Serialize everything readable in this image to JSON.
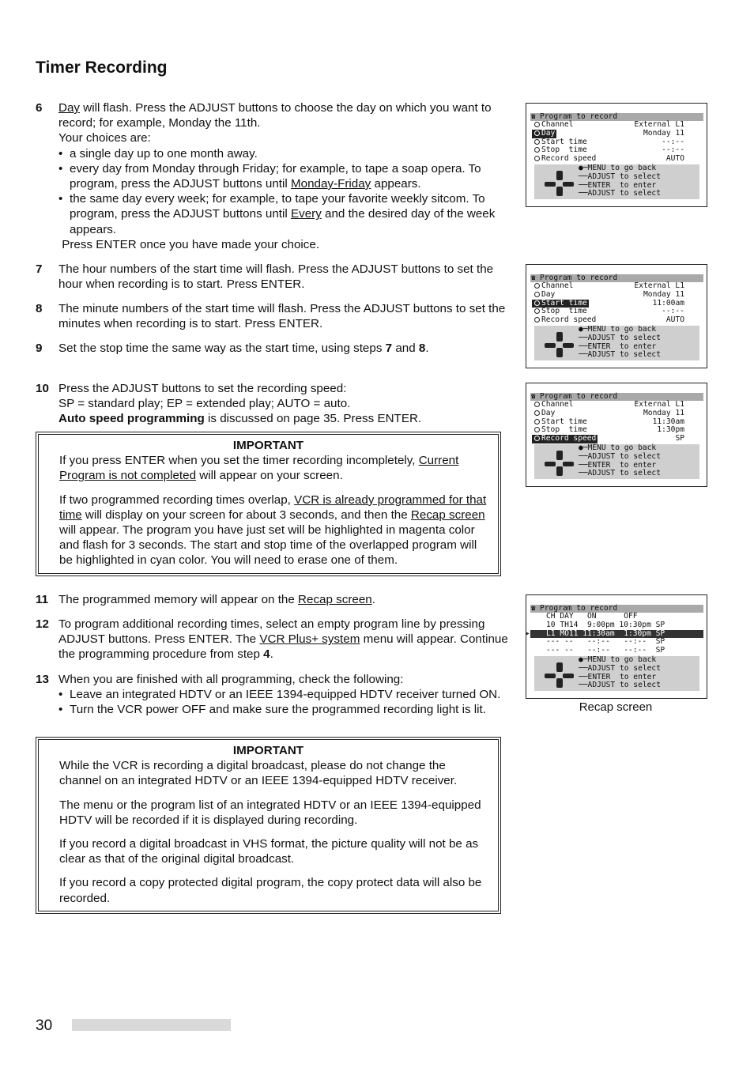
{
  "page": {
    "title": "Timer Recording",
    "page_number": "30"
  },
  "steps": {
    "s6": {
      "num": "6",
      "l1a": "Day",
      "l1b": " will flash.  Press the ADJUST buttons to choose the day on which you want to record; for example, Monday the 11th.",
      "l2": "Your choices are:",
      "b1": "a single day up to one month away.",
      "b2a": "every day from Monday through Friday; for example, to tape a soap opera. To program, press the ADJUST buttons until ",
      "b2u": "Monday-Friday",
      "b2b": " appears.",
      "b3a": "the same day every week; for example, to tape your favorite weekly sitcom. To program, press the ADJUST buttons until ",
      "b3u": "Every",
      "b3b": " and the desired day of the week appears.",
      "end": " Press ENTER once you have made your choice."
    },
    "s7": {
      "num": "7",
      "text": "The hour numbers of the start time will flash.  Press the ADJUST buttons to set the hour when recording is to start.  Press ENTER."
    },
    "s8": {
      "num": "8",
      "text": "The minute numbers of the start time will flash.  Press the ADJUST buttons to set the minutes when recording is to start.  Press ENTER."
    },
    "s9": {
      "num": "9",
      "a": "Set the stop time the same way as the start time, using steps ",
      "b1": "7",
      "m": " and ",
      "b2": "8",
      "e": "."
    },
    "s10": {
      "num": "10",
      "l1": "Press the ADJUST buttons to set the recording speed:",
      "l2": "SP = standard play; EP = extended play; AUTO = auto.",
      "l3b": "Auto speed programming",
      "l3": " is discussed on page 35.  Press ENTER."
    },
    "s11": {
      "num": "11",
      "a": "The programmed memory will appear on the ",
      "u": "Recap screen",
      "e": "."
    },
    "s12": {
      "num": "12",
      "a": "To program additional recording times, select an empty program line by pressing ADJUST buttons.  Press ENTER.  The ",
      "u": "VCR Plus+ system",
      "b": " menu will appear.  Continue the programming procedure from step ",
      "bold": "4",
      "e": "."
    },
    "s13": {
      "num": "13",
      "l1": "When you are finished with all programming, check the following:",
      "b1": "Leave an integrated HDTV or an IEEE 1394-equipped HDTV receiver turned ON.",
      "b2": "Turn the VCR power OFF and make sure the programmed recording light is lit."
    }
  },
  "important1": {
    "head": "IMPORTANT",
    "p1a": "If you press ENTER when you set the timer recording incompletely, ",
    "p1u": "Current Program is not completed",
    "p1b": " will appear on your screen.",
    "p2a": "If two programmed recording times overlap, ",
    "p2u1": "VCR is already programmed for that time",
    "p2b": " will display on your screen for about 3 seconds, and then the ",
    "p2u2": "Recap screen",
    "p2c": " will appear.  The program you have just set will be highlighted in magenta color and flash for 3 seconds.  The start and stop time of the overlapped program will be highlighted in cyan color.  You will need to erase one of them."
  },
  "important2": {
    "head": "IMPORTANT",
    "p1": "While the VCR is recording a digital broadcast, please do not change the channel on an integrated HDTV or an IEEE 1394-equipped HDTV receiver.",
    "p2": "The menu or the program list of an integrated HDTV or an IEEE 1394-equipped HDTV will be recorded if it is displayed during recording.",
    "p3": "If you record a digital broadcast in VHS format, the picture quality will not be as clear as that of the original digital broadcast.",
    "p4": "If you record a copy protected digital program, the copy protect data will also be recorded."
  },
  "osd_common": {
    "header": "Program to record",
    "phone_icon": "☎",
    "labels": [
      "Channel",
      "Day",
      "Start time",
      "Stop  time",
      "Record speed"
    ],
    "help": [
      "MENU to go back",
      "ADJUST to select",
      "ENTER  to enter",
      "ADJUST to select"
    ]
  },
  "osd1": {
    "selected": "Day",
    "values": [
      "External L1",
      "Monday 11",
      "--:--",
      "--:--",
      "AUTO"
    ]
  },
  "osd2": {
    "selected": "Start time",
    "values": [
      "External L1",
      "Monday 11",
      "11:00am",
      "--:--",
      "AUTO"
    ]
  },
  "osd3": {
    "selected": "Record speed",
    "values": [
      "External L1",
      "Monday 11",
      "11:30am",
      "1:30pm",
      "SP"
    ]
  },
  "recap": {
    "header_row": "CH DAY   ON      OFF",
    "rows": [
      "10 TH14  9:00pm 10:30pm SP",
      "L1 MO11 11:30am  1:30pm SP",
      "--- --   --:--   --:--  SP",
      "--- --   --:--   --:--  SP"
    ],
    "selected_row": 1,
    "caption": "Recap screen"
  }
}
